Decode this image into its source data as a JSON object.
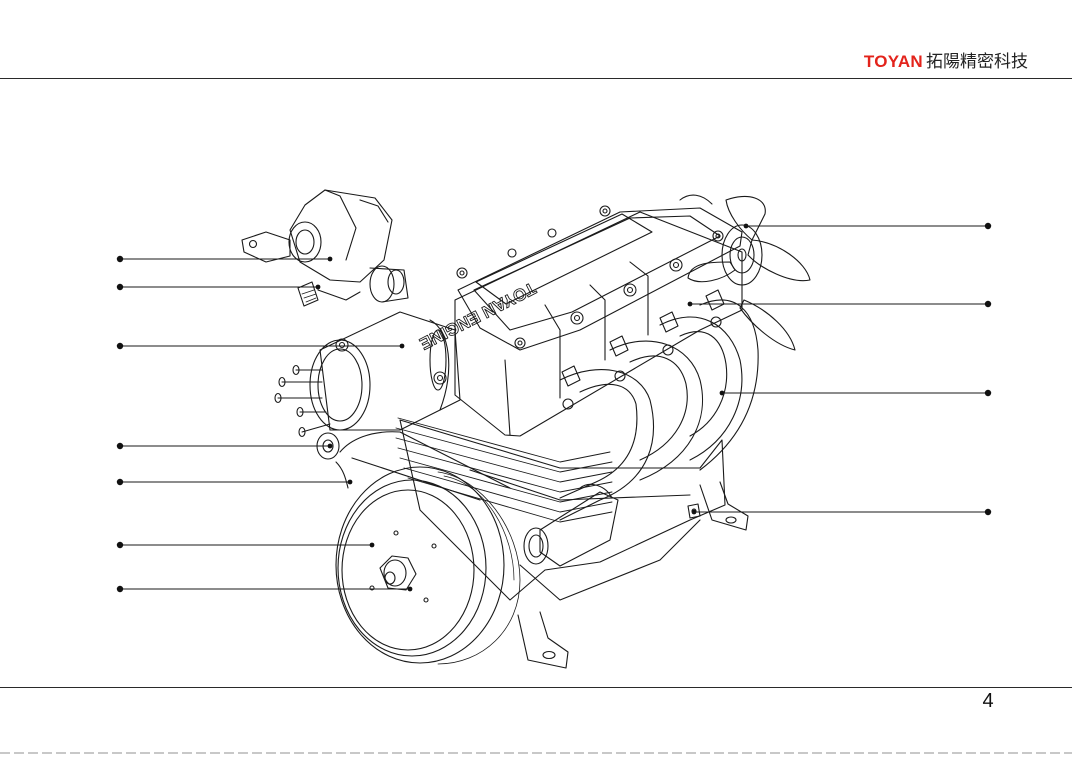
{
  "header": {
    "brand_name": "TOYAN",
    "brand_chinese": "拓陽精密科技"
  },
  "illustration": {
    "subject": "engine-exploded-illustration",
    "engraved_text": "TOYAN ENGINE"
  },
  "footer": {
    "page_number": "4"
  },
  "colors": {
    "brand_red": "#e3231b",
    "line": "#1a1a1a",
    "rule": "#2a2a2a"
  }
}
